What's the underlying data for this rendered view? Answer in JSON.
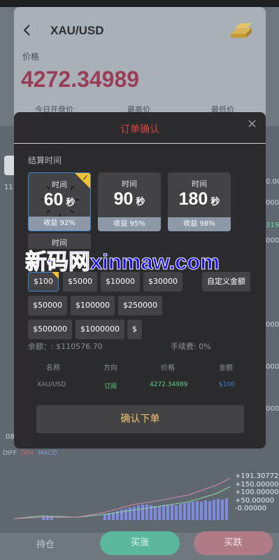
{
  "header": {
    "pair": "XAU/USD",
    "price_label": "价格",
    "price": "4272.34989",
    "stats": [
      "今日开盘价",
      "最高价",
      "最低价"
    ]
  },
  "background": {
    "time_tick": "11:",
    "side_values": [
      "0.00",
      "0000",
      "319",
      "0000",
      "0000",
      "0000",
      "0000"
    ],
    "left_tick": "08",
    "diff_labels": [
      "DIFF",
      "DEA",
      "MACD"
    ],
    "macd_labels": [
      "+191.30772",
      "+150.00000",
      "+100.00000",
      "+50.00000",
      "-0.00000"
    ],
    "actions": {
      "hold": "持仓",
      "buy_up": "买涨",
      "buy_down": "买跌"
    }
  },
  "modal": {
    "title": "订单确认",
    "close_glyph": "×",
    "section_label": "结算时间",
    "time_options": [
      {
        "label": "时间",
        "value": "60",
        "unit": "秒",
        "yield": "收益 92%",
        "selected": true
      },
      {
        "label": "时间",
        "value": "90",
        "unit": "秒",
        "yield": "收益 95%",
        "selected": false
      },
      {
        "label": "时间",
        "value": "180",
        "unit": "秒",
        "yield": "收益 98%",
        "selected": false
      },
      {
        "label": "时间",
        "value": "",
        "unit": "",
        "yield": "",
        "selected": false
      }
    ],
    "amounts": [
      "$100",
      "$5000",
      "$10000",
      "$30000",
      "自定义金额",
      "$50000",
      "$100000",
      "$250000",
      "$500000",
      "$1000000",
      "$"
    ],
    "selected_amount": "$100",
    "balance": "余额：: $110576.70",
    "fee": "手续费: 0%",
    "table": {
      "headers": [
        "名称",
        "方向",
        "价格",
        "金额"
      ],
      "row": [
        "XAU/USD",
        "订阅",
        "4272.34989",
        "$100"
      ]
    },
    "confirm": "确认下单"
  },
  "watermark": "新码网xinmaw.com",
  "colors": {
    "accent_red": "#d8463f",
    "gold": "#efc56d",
    "select_blue": "#3d86d6",
    "green": "#5fd37f",
    "price_pink": "#9b3d55"
  }
}
